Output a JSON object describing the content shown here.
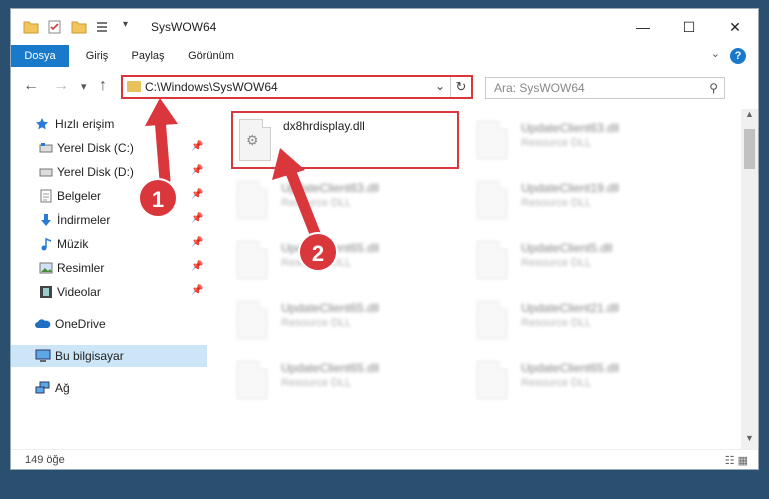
{
  "window": {
    "title": "SysWOW64",
    "controls": {
      "minimize": "—",
      "maximize": "☐",
      "close": "✕"
    }
  },
  "ribbon": {
    "tabs": [
      "Dosya",
      "Giriş",
      "Paylaş",
      "Görünüm"
    ],
    "expand_icon": "chevron-down-icon",
    "help": "?"
  },
  "nav": {
    "back": "←",
    "forward": "→",
    "recent": "▾",
    "up": "↑",
    "address": "C:\\Windows\\SysWOW64",
    "refresh": "↻",
    "search_placeholder": "Ara: SysWOW64"
  },
  "sidebar": {
    "items": [
      {
        "label": "Hızlı erişim",
        "icon": "star-icon",
        "pinned": false,
        "top": true
      },
      {
        "label": "Yerel Disk (C:)",
        "icon": "drive-icon",
        "pinned": true
      },
      {
        "label": "Yerel Disk (D:)",
        "icon": "drive-icon",
        "pinned": true
      },
      {
        "label": "Belgeler",
        "icon": "document-icon",
        "pinned": true
      },
      {
        "label": "İndirmeler",
        "icon": "download-icon",
        "pinned": true
      },
      {
        "label": "Müzik",
        "icon": "music-icon",
        "pinned": true
      },
      {
        "label": "Resimler",
        "icon": "pictures-icon",
        "pinned": true
      },
      {
        "label": "Videolar",
        "icon": "video-icon",
        "pinned": true
      },
      {
        "label": "OneDrive",
        "icon": "cloud-icon",
        "pinned": false,
        "top": true
      },
      {
        "label": "Bu bilgisayar",
        "icon": "computer-icon",
        "pinned": false,
        "top": true,
        "selected": true
      },
      {
        "label": "Ağ",
        "icon": "network-icon",
        "pinned": false,
        "top": true
      }
    ]
  },
  "files": {
    "highlighted": {
      "name": "dx8hrdisplay.dll"
    },
    "left_column": [
      {
        "name": "UpdateClient63.dll",
        "type": "Resource DLL"
      },
      {
        "name": "UpdateClient65.dll",
        "type": "Resource DLL"
      },
      {
        "name": "UpdateClient65.dll",
        "type": "Resource DLL"
      },
      {
        "name": "UpdateClient65.dll",
        "type": "Resource DLL"
      }
    ],
    "right_column": [
      {
        "name": "UpdateClient63.dll",
        "type": "Resource DLL"
      },
      {
        "name": "UpdateClient19.dll",
        "type": "Resource DLL"
      },
      {
        "name": "UpdateClient5.dll",
        "type": "Resource DLL"
      },
      {
        "name": "UpdateClient21.dll",
        "type": "Resource DLL"
      },
      {
        "name": "UpdateClient65.dll",
        "type": "Resource DLL"
      }
    ]
  },
  "status": {
    "count": "149 öğe"
  },
  "annotations": {
    "step1": "1",
    "step2": "2",
    "color": "#d9373b"
  }
}
